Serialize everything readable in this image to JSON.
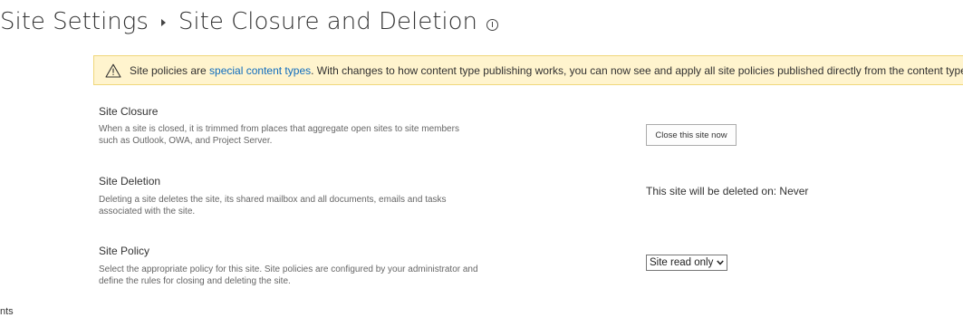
{
  "header": {
    "breadcrumb_root": "Site Settings",
    "page_title": "Site Closure and Deletion"
  },
  "banner": {
    "text_before_link": "Site policies are ",
    "link_text": "special content types",
    "text_after_link": ". With changes to how content type publishing works, you can now see and apply all site policies published directly from the content type hub."
  },
  "sections": {
    "closure": {
      "title": "Site Closure",
      "description": "When a site is closed, it is trimmed from places that aggregate open sites to site members such as Outlook, OWA, and Project Server.",
      "button_label": "Close this site now"
    },
    "deletion": {
      "title": "Site Deletion",
      "description": "Deleting a site deletes the site, its shared mailbox and all documents, emails and tasks associated with the site.",
      "status_text": "This site will be deleted on: Never"
    },
    "policy": {
      "title": "Site Policy",
      "description": "Select the appropriate policy for this site. Site policies are configured by your administrator and define the rules for closing and deleting the site.",
      "selected_value": "Site read only"
    }
  },
  "left_nav": {
    "partial_item": "nts"
  },
  "colors": {
    "banner_bg": "#fff4ce",
    "banner_border": "#f0d77b",
    "link": "#0f6cbd"
  },
  "icons": {
    "title_info": "info-icon",
    "banner_warning": "warning-icon",
    "dropdown": "chevron-down-icon"
  }
}
